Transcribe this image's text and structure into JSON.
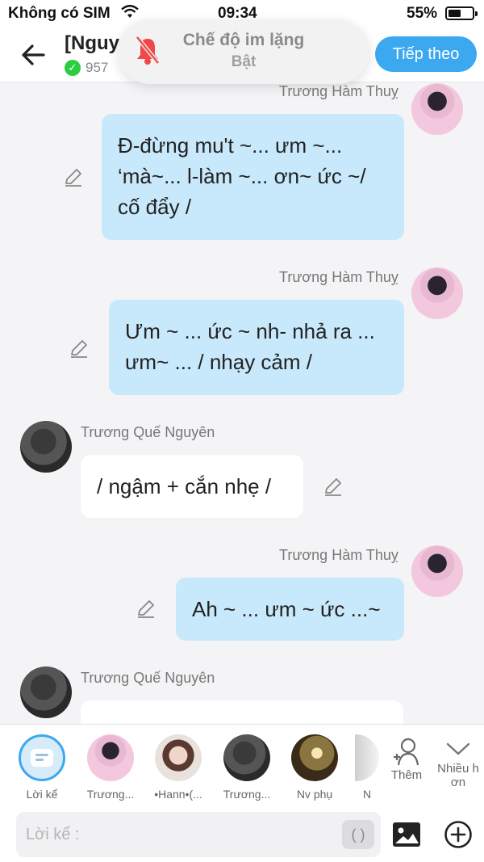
{
  "status_bar": {
    "carrier": "Không có SIM",
    "time": "09:34",
    "battery_percent": "55%",
    "battery_level": 0.55
  },
  "header": {
    "title": "[Nguy",
    "subtitle": "957",
    "next_label": "Tiếp theo",
    "verified": true
  },
  "toast": {
    "title": "Chế độ im lặng",
    "subtitle": "Bật",
    "icon": "bell-muted-icon"
  },
  "messages": [
    {
      "sender": "Trương Hàm Thuỵ",
      "direction": "out",
      "lines": [
        "Đ-đừng mu't ~... ưm ~...",
        "‘mà~... l-làm ~... ơn~ ức ~/",
        "cố đẩy /"
      ]
    },
    {
      "sender": "Trương Hàm Thuỵ",
      "direction": "out",
      "lines": [
        "Ưm ~ ... ức ~ nh- nhả ra ...",
        "ưm~ ... / nhạy cảm /"
      ]
    },
    {
      "sender": "Trương Quế Nguyên",
      "direction": "in",
      "lines": [
        "/ ngậm + cắn nhẹ /"
      ]
    },
    {
      "sender": "Trương Hàm Thuỵ",
      "direction": "out",
      "lines": [
        "Ah ~ ... ưm ~ ức ...~"
      ]
    },
    {
      "sender": "Trương Quế Nguyên",
      "direction": "in",
      "lines": [
        ""
      ]
    }
  ],
  "characters": [
    {
      "label": "Lời kể",
      "selected": true
    },
    {
      "label": "Trương..."
    },
    {
      "label": "•Hann•(..."
    },
    {
      "label": "Trương..."
    },
    {
      "label": "Nv phụ"
    },
    {
      "label": "N"
    }
  ],
  "side_buttons": {
    "add_label": "Thêm",
    "more_label_1": "Nhiều h",
    "more_label_2": "ơn"
  },
  "composer": {
    "placeholder": "Lời kể :",
    "paren_label": "( )"
  },
  "colors": {
    "accent": "#3ba8f0",
    "outgoing_bubble": "#c8e9fb",
    "incoming_bubble": "#ffffff",
    "background": "#f4f4f6"
  }
}
